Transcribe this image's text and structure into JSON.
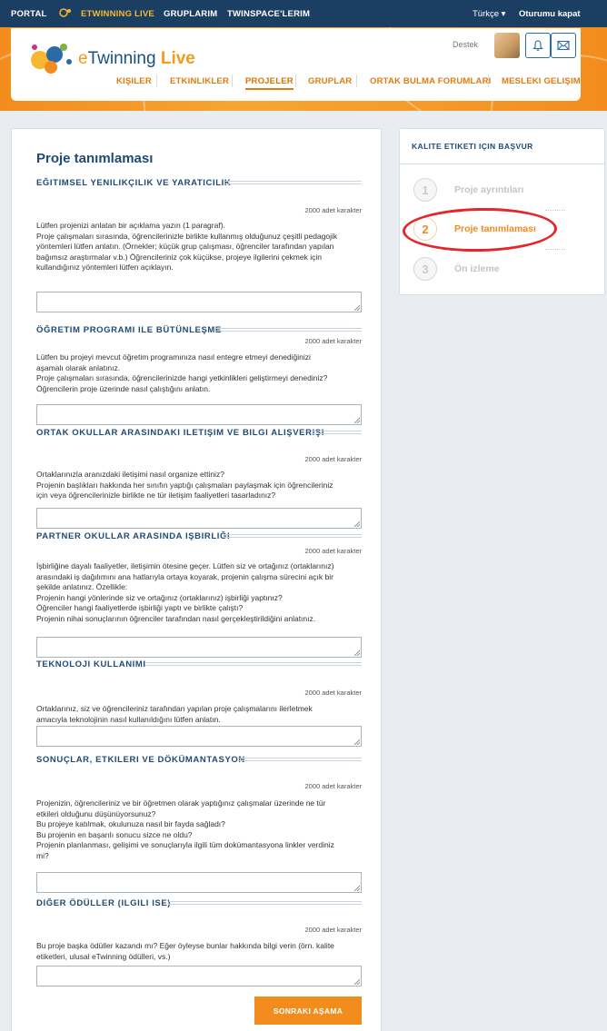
{
  "topbar": {
    "portal": "PORTAL",
    "etwinning_live": "ETWINNING LIVE",
    "gruplarim": "GRUPLARIM",
    "twinspace": "TWINSPACE'LERIM",
    "language": "Türkçe ▾",
    "logout": "Oturumu kapat"
  },
  "brand": {
    "prefix": "e",
    "name": "Twinning",
    "suffix": " Live"
  },
  "header": {
    "support": "Destek"
  },
  "nav": [
    "KIŞILER",
    "ETKINLIKLER",
    "PROJELER",
    "GRUPLAR",
    "ORTAK BULMA FORUMLARI",
    "MESLEKI GELIŞIM"
  ],
  "page": {
    "title": "Proje tanımlaması",
    "next_button": "SONRAKI AŞAMA"
  },
  "sections": [
    {
      "heading": "EĞITIMSEL YENILIKÇILIK VE YARATICILIK",
      "count": "2000 adet karakter",
      "lines": [
        "Lütfen projenizi anlatan bir açıklama yazın (1 paragraf).",
        "Proje çalışmaları sırasında, öğrencilerinizle birlikte kullanmış olduğunuz çeşitli pedagojik",
        "yöntemleri lütfen anlatın. (Örnekler; küçük grup çalışması, öğrenciler tarafından yapılan",
        "bağımsız araştırmalar v.b.) Öğrencileriniz çok küçükse, projeye ilgilerini çekmek için",
        "kullandığınız yöntemleri lütfen açıklayın."
      ],
      "value": ""
    },
    {
      "heading": "ÖĞRETIM PROGRAMI ILE BÜTÜNLEŞME",
      "count": "2000 adet karakter",
      "lines": [
        "Lütfen bu projeyi mevcut öğretim programınıza nasıl entegre etmeyi denediğinizi",
        "aşamalı olarak anlatınız.",
        "Proje çalışmaları sırasında, öğrencilerinizde hangi yetkinlikleri geliştirmeyi denediniz?",
        "Öğrencilerin proje üzerinde nasıl çalıştığını anlatın."
      ],
      "value": ""
    },
    {
      "heading": "ORTAK OKULLAR ARASINDAKI ILETIŞIM VE BILGI ALIŞVERIŞI",
      "count": "2000 adet karakter",
      "lines": [
        "Ortaklarınızla aranızdaki iletişimi nasıl organize ettiniz?",
        "Projenin başlıkları hakkında her sınıfın yaptığı çalışmaları paylaşmak için öğrencileriniz",
        "için veya öğrencilerinizle birlikte ne tür iletişim faaliyetleri tasarladınız?"
      ],
      "value": ""
    },
    {
      "heading": "PARTNER OKULLAR ARASINDA IŞBIRLIĞI",
      "count": "2000 adet karakter",
      "lines": [
        "İşbirliğine dayalı faaliyetler, iletişimin ötesine geçer. Lütfen siz ve ortağınız (ortaklarınız)",
        "arasındaki iş dağılımını ana hatlarıyla ortaya koyarak, projenin çalışma sürecini açık bir",
        "şekilde anlatınız. Özellikle:",
        "Projenin hangi yönlerinde siz ve ortağınız (ortaklarınız) işbirliği yaptınız?",
        "Öğrenciler hangi faaliyetlerde işbirliği yaptı ve birlikte çalıştı?",
        "Projenin nihai sonuçlarının öğrenciler tarafından nasıl gerçekleştirildiğini anlatınız."
      ],
      "value": ""
    },
    {
      "heading": "TEKNOLOJI KULLANIMI",
      "count": "2000 adet karakter",
      "lines": [
        "Ortaklarınız, siz ve öğrencileriniz tarafından yapılan proje çalışmalarını ilerletmek",
        "amacıyla teknolojinin nasıl kullanıldığını lütfen anlatın."
      ],
      "value": ""
    },
    {
      "heading": "SONUÇLAR, ETKILERI VE DÖKÜMANTASYON",
      "count": "2000 adet karakter",
      "lines": [
        "Projenizin, öğrencileriniz ve bir öğretmen olarak yaptığınız çalışmalar üzerinde ne tür",
        "etkileri olduğunu düşünüyorsunuz?",
        "Bu projeye katılmak, okulunuza nasıl bir fayda sağladı?",
        "Bu projenin en başarılı sonucu sizce ne oldu?",
        "Projenin planlanması, gelişimi ve sonuçlarıyla ilgili tüm dokümantasyona linkler verdiniz",
        "mi?"
      ],
      "value": ""
    },
    {
      "heading": "DIĞER ÖDÜLLER (ILGILI ISE)",
      "count": "2000 adet karakter",
      "lines": [
        "Bu proje başka ödüller kazandı mı? Eğer öyleyse bunlar hakkında bilgi verin (örn. kalite",
        "etiketleri, ulusal eTwinning ödülleri, vs.)"
      ],
      "value": ""
    }
  ],
  "sidebar": {
    "title": "KALITE ETIKETI IÇIN BAŞVUR",
    "steps": [
      {
        "num": "1",
        "label": "Proje ayrıntıları"
      },
      {
        "num": "2",
        "label": "Proje tanımlaması"
      },
      {
        "num": "3",
        "label": "Ön izleme"
      }
    ],
    "active_step": 2
  },
  "colors": {
    "accent": "#f28c1d",
    "navy": "#1b3f63",
    "annotation": "#e3262a"
  },
  "icons": [
    "etwinning-logo-icon",
    "bell-icon",
    "mail-icon",
    "resize-grip-icon"
  ]
}
